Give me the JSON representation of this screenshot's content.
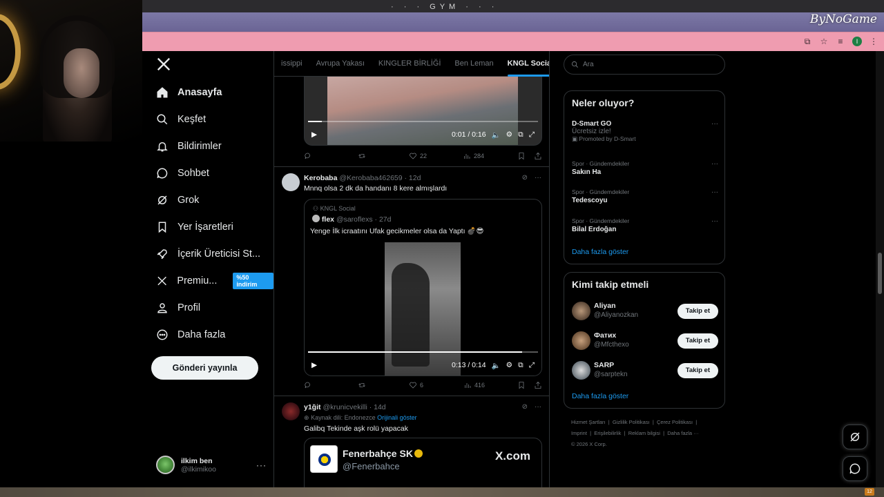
{
  "browser": {
    "brand_overlay": "ByNoGame",
    "tabstrip_text": "· ·  ·  GYM  · · ·",
    "profile_initial": "I"
  },
  "sidebar": {
    "items": [
      {
        "label": "Anasayfa",
        "icon": "home-icon"
      },
      {
        "label": "Keşfet",
        "icon": "search-icon"
      },
      {
        "label": "Bildirimler",
        "icon": "bell-icon"
      },
      {
        "label": "Sohbet",
        "icon": "chat-icon"
      },
      {
        "label": "Grok",
        "icon": "grok-icon"
      },
      {
        "label": "Yer İşaretleri",
        "icon": "bookmark-icon"
      },
      {
        "label": "İçerik Üreticisi St...",
        "icon": "rocket-icon"
      },
      {
        "label": "Premiu...",
        "icon": "x-icon",
        "badge": "%50 indirim"
      },
      {
        "label": "Profil",
        "icon": "person-icon"
      },
      {
        "label": "Daha fazla",
        "icon": "more-circle-icon"
      }
    ],
    "post_button": "Gönderi yayınla",
    "account": {
      "name": "ilkim ben",
      "handle": "@ilkimikoo",
      "more": "···"
    }
  },
  "feed": {
    "tabs": [
      "issippi",
      "Avrupa Yakası",
      "KINGLER BİRLİĞİ",
      "Ben Leman",
      "KNGL Social"
    ],
    "video1": {
      "time": "0:01 / 0:16",
      "progress": 0.06
    },
    "post0_actions": {
      "likes": "22",
      "views": "284"
    },
    "post1": {
      "name": "Kerobaba",
      "meta": "@Kerobaba462659 · 12d",
      "text": "Mnnq olsa 2 dk da handanı 8 kere almışlardı",
      "quote": {
        "community": "KNGL Social",
        "author": "flex",
        "author_meta": "@saroflexs · 27d",
        "text": "Yenge İlk icraatını Ufak gecikmeler olsa da Yaptı 💣😎",
        "video_time": "0:13 / 0:14",
        "video_progress": 0.93
      },
      "actions": {
        "likes": "6",
        "views": "416"
      }
    },
    "post2": {
      "name": "y1ğit",
      "meta": "@krunicvekilli · 14d",
      "source_lang": "Kaynak dili: Endonezce",
      "show_original": "Orijinali göster",
      "text": "Galibq Tekinde aşk rolü yapacak",
      "card": {
        "name": "Fenerbahçe SK",
        "handle": "@Fenerbahce",
        "site": "X.com"
      }
    }
  },
  "right": {
    "search_placeholder": "Ara",
    "trends_title": "Neler oluyor?",
    "promoted": {
      "name": "D-Smart GO",
      "sub": "Ücretsiz izle!",
      "promoted": "Promoted by D-Smart"
    },
    "trends": [
      {
        "cat": "Spor · Gündemdekiler",
        "name": "Sakın Ha"
      },
      {
        "cat": "Spor · Gündemdekiler",
        "name": "Tedescoyu"
      },
      {
        "cat": "Spor · Gündemdekiler",
        "name": "Bilal Erdoğan"
      }
    ],
    "show_more": "Daha fazla göster",
    "follow_title": "Kimi takip etmeli",
    "follow": [
      {
        "name": "Aliyan",
        "handle": "@Aliyanozkan",
        "btn": "Takip et"
      },
      {
        "name": "Фатих",
        "handle": "@Mfcthexo",
        "btn": "Takip et"
      },
      {
        "name": "SARP",
        "handle": "@sarptekn",
        "btn": "Takip et"
      }
    ],
    "footer": [
      "Hizmet Şartları",
      "Gizlilik Politikası",
      "Çerez Politikası",
      "Imprint",
      "Erişilebilirlik",
      "Reklam bilgisi",
      "Daha fazla ···",
      "© 2026 X Corp."
    ]
  },
  "taskbar": {
    "tray_count": "12"
  },
  "colors": {
    "accent": "#1d9bf0",
    "background": "#000000",
    "address_bar": "#ef9cb0"
  }
}
